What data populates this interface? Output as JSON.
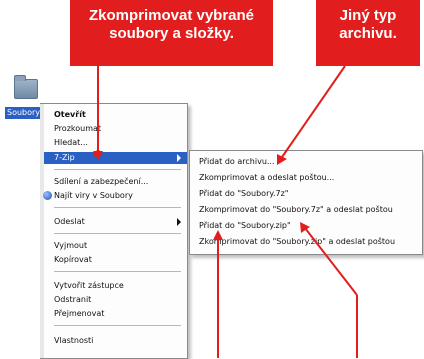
{
  "callouts": {
    "left": "Zkomprimovat vybrané\nsoubory a složky.",
    "right": "Jiný typ\narchivu."
  },
  "desktop": {
    "folder_label": "Soubory"
  },
  "context_menu": {
    "items": [
      "Otevřít",
      "Prozkoumat",
      "Hledat...",
      "7-Zip",
      "Sdílení a zabezpečení...",
      "Najít viry v Soubory",
      "Odeslat",
      "Vyjmout",
      "Kopírovat",
      "Vytvořit zástupce",
      "Odstranit",
      "Přejmenovat",
      "Vlastnosti"
    ]
  },
  "submenu": {
    "items": [
      "Přidat do archivu...",
      "Zkomprimovat a odeslat poštou...",
      "Přidat do \"Soubory.7z\"",
      "Zkomprimovat do \"Soubory.7z\" a odeslat poštou",
      "Přidat do \"Soubory.zip\"",
      "Zkomprimovat do \"Soubory.zip\" a odeslat poštou"
    ]
  },
  "colors": {
    "callout": "#e21d1d",
    "selection": "#2a5fc4"
  }
}
